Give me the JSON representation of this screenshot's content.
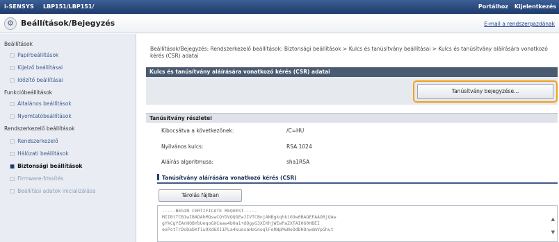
{
  "topbar": {
    "brand": "i-SENSYS",
    "model": "LBP151/LBP151/",
    "link_portal": "Portálhoz",
    "link_logout": "Kijelentkezés"
  },
  "header": {
    "title": "Beállítások/Bejegyzés",
    "email_link": "E-mail a rendszergazdának"
  },
  "sidebar": {
    "groups": [
      "Beállítások",
      "Funkcióbeállítások",
      "Rendszerkezelő beállítások"
    ],
    "items": [
      "Papírbeállítások",
      "Kijelző beállításai",
      "Időzítő beállításai",
      "Általános beállítások",
      "Nyomtatóbeállítások",
      "Rendszerkezelő",
      "Hálózati beállítások",
      "Biztonsági beállítások",
      "Firmware-frissítés",
      "Beállítási adatok inicializálása"
    ]
  },
  "breadcrumb": "Beállítások/Bejegyzés: Rendszerkezelő beállítások: Biztonsági beállítások > Kulcs és tanúsítvány beállításai > Kulcs és tanúsítvány aláírására vonatkozó kérés (CSR) adatai",
  "csr_panel": {
    "title": "Kulcs és tanúsítvány aláírására vonatkozó kérés (CSR) adatai",
    "register_button": "Tanúsítvány bejegyzése..."
  },
  "details": {
    "title": "Tanúsítvány részletei",
    "rows": [
      {
        "label": "Kibocsátva a következőnek:",
        "value": "/C=HU"
      },
      {
        "label": "Nyilvános kulcs:",
        "value": "RSA 1024"
      },
      {
        "label": "Aláírás algoritmusa:",
        "value": "sha1RSA"
      }
    ]
  },
  "csr_section": {
    "title": "Tanúsítvány aláírására vonatkozó kérés (CSR)",
    "save_button": "Tárolás fájlban",
    "lines": [
      "-----BEGIN CERTIFICATE REQUEST-----",
      "MIIBtTCB1wIBADAhMQswCQYDVQQGEwJIVTCBnjANBgkqhkiG9w0BAQEFAAOBjQAw",
      "gYkCgYEAnHOBYbUeqoGXCaaw4b0a1+dOgyG3XIKhjWEwPaZXTAI0G0HBEI",
      "eoPotTrDoDabKf1u9Xd6X11PLa4kuoxaHoGnoqlFeRNpMwNoDdbHOnwdmVpGhut"
    ]
  },
  "scroll": {
    "up": "▲",
    "down": "▼"
  }
}
